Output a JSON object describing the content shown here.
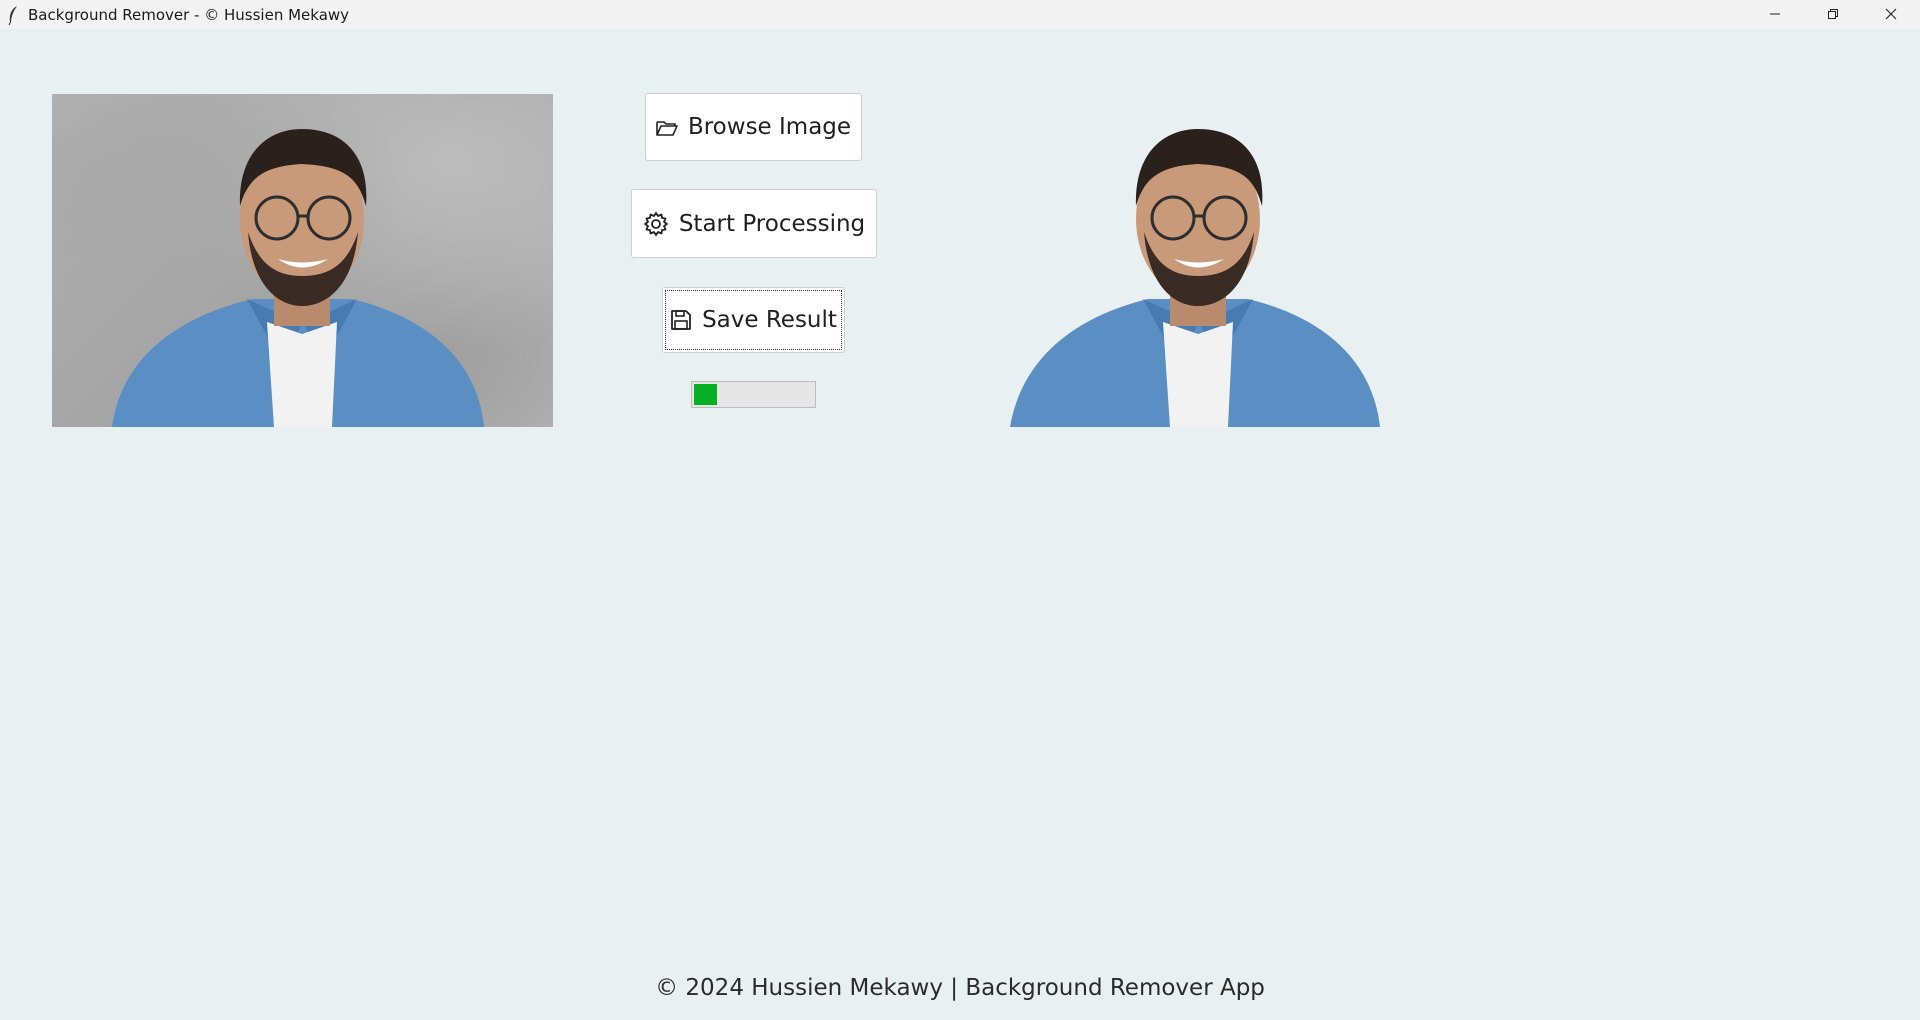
{
  "window": {
    "title": "Background Remover - © Hussien Mekawy"
  },
  "icons": {
    "app": "feather-icon",
    "minimize": "minimize-icon",
    "maximize": "restore-icon",
    "close": "close-icon",
    "browse": "folder-open-icon",
    "process": "gear-icon",
    "save": "floppy-disk-icon"
  },
  "buttons": {
    "browse_label": "Browse Image",
    "process_label": "Start Processing",
    "save_label": "Save Result"
  },
  "progress": {
    "value": 0.19,
    "color": "#06b025"
  },
  "footer": {
    "text": "© 2024 Hussien Mekawy | Background Remover App"
  },
  "colors": {
    "background": "#e8f0f1",
    "titlebar": "#f3f3f3",
    "shirt": "#5b8fc4",
    "skin": "#c99a7a"
  }
}
